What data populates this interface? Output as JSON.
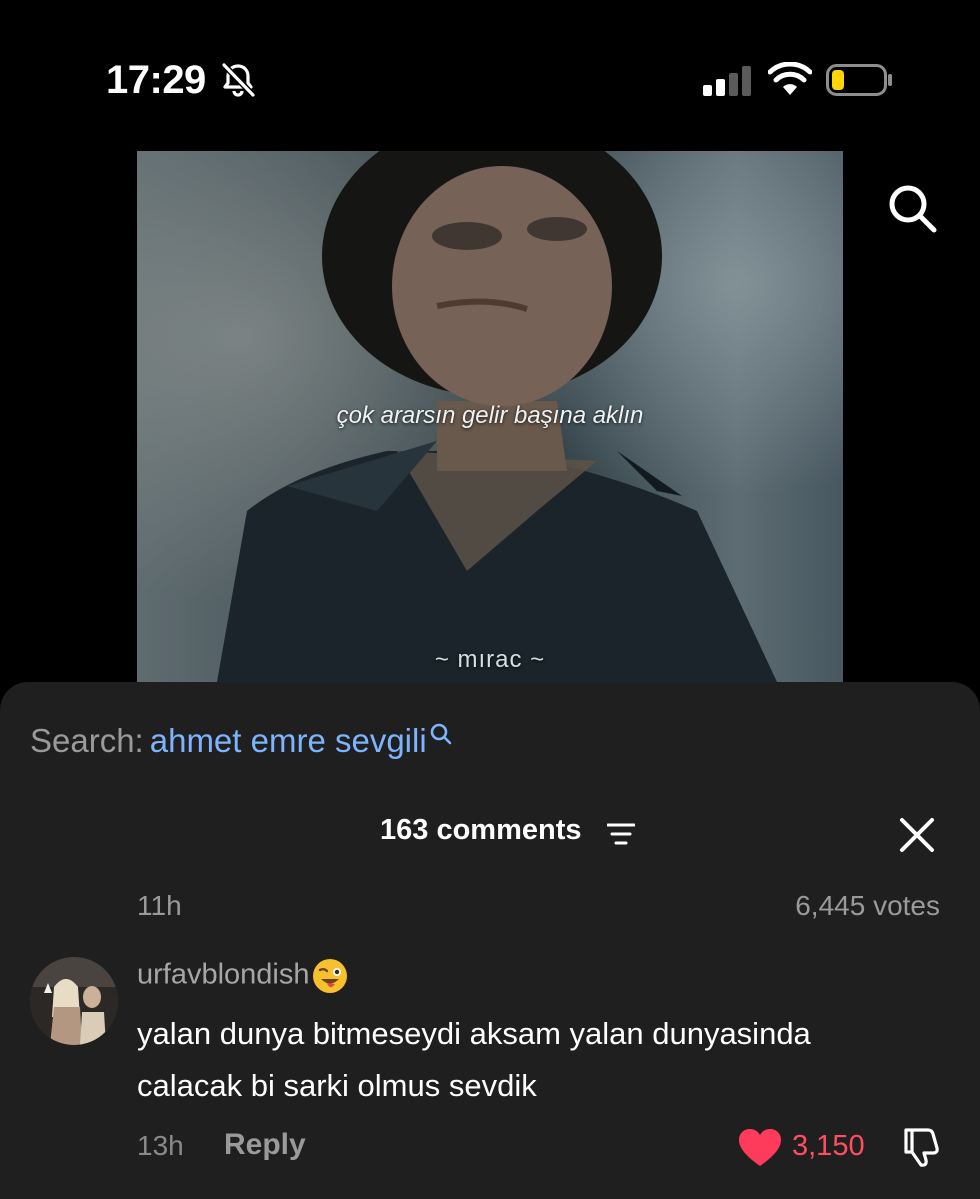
{
  "status_bar": {
    "time": "17:29",
    "icons": [
      "bell-slash-icon",
      "signal-icon",
      "wifi-icon",
      "battery-low-icon"
    ]
  },
  "video": {
    "caption": "çok ararsın gelir başına aklın",
    "credit": "~ mırac ~"
  },
  "top_search_icon": "search-icon",
  "sheet": {
    "search_prefix": "Search:",
    "search_term": "ahmet emre sevgili",
    "comment_count_label": "163 comments",
    "comment_age": "11h",
    "votes": "6,445 votes",
    "comment": {
      "username": "urfavblondish",
      "text": "yalan dunya bitmeseydi aksam yalan dunyasinda calacak bi sarki olmus sevdik",
      "age": "13h",
      "reply_label": "Reply",
      "likes": "3,150",
      "liked": true
    }
  },
  "colors": {
    "background": "#000000",
    "sheet": "#1f1f1f",
    "link_blue": "#7db3ff",
    "like_red": "#ff3b5c",
    "battery_yellow": "#ffd60a"
  }
}
